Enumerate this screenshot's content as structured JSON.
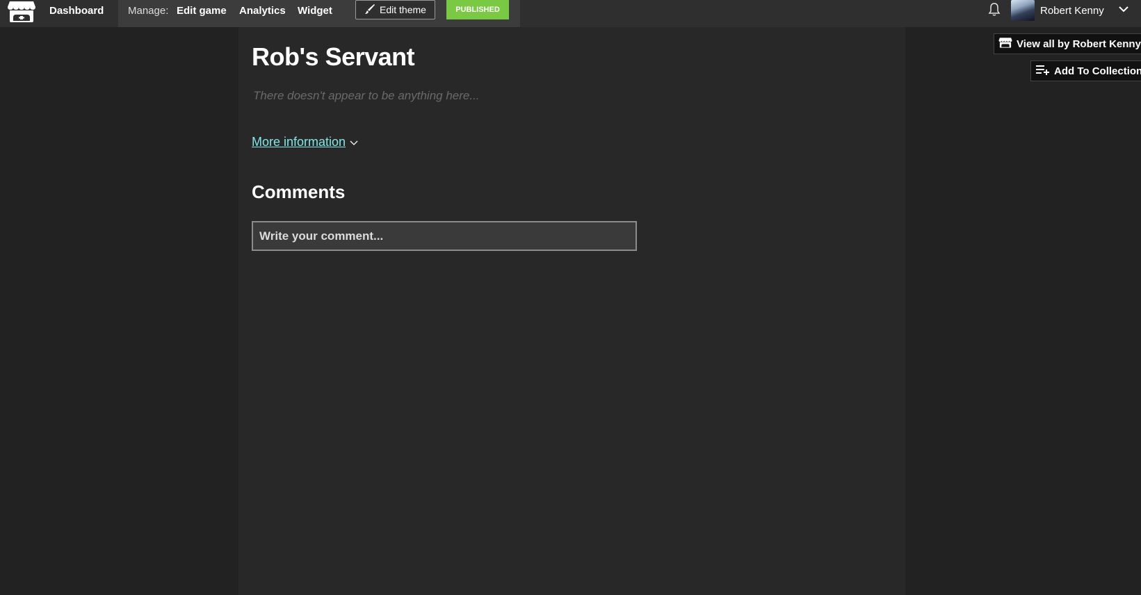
{
  "header": {
    "logo_icon": "itchio-logo-icon",
    "dashboard_label": "Dashboard",
    "manage": {
      "label": "Manage:",
      "links": [
        "Edit game",
        "Analytics",
        "Widget"
      ],
      "edit_theme_label": "Edit theme",
      "edit_theme_icon": "paintbrush-icon",
      "status_badge": "PUBLISHED",
      "status_color": "#7ac943"
    },
    "notifications_icon": "bell-icon",
    "user": {
      "name": "Robert Kenny",
      "menu_icon": "chevron-down-icon"
    }
  },
  "game": {
    "title": "Rob's Servant",
    "description_placeholder": "There doesn't appear to be anything here...",
    "more_info_label": "More information",
    "more_info_icon": "chevron-down-icon",
    "link_color": "#7fe8e4"
  },
  "comments": {
    "heading": "Comments",
    "input_placeholder": "Write your comment..."
  },
  "sidebar_actions": {
    "view_all_label": "View all by Robert Kenny",
    "view_all_icon": "itchio-logo-icon",
    "add_collection_label": "Add To Collection",
    "add_collection_icon": "playlist-add-icon"
  }
}
